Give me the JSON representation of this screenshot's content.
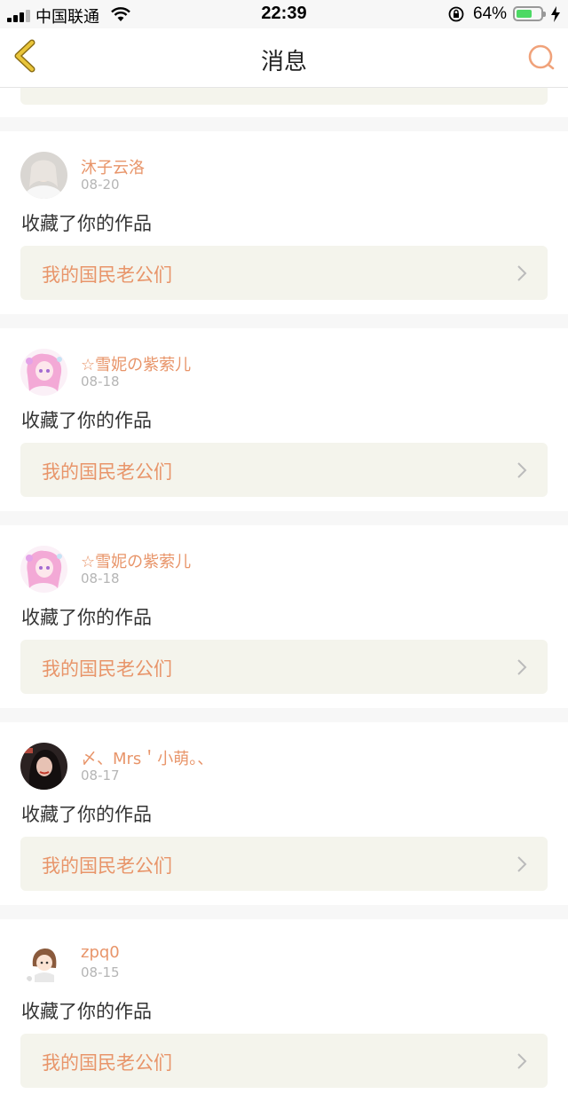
{
  "status_bar": {
    "carrier": "中国联通",
    "time": "22:39",
    "battery": "64%",
    "battery_level": 0.64
  },
  "nav": {
    "title": "消息",
    "back_icon": "chevron-left-icon",
    "search_icon": "search-icon"
  },
  "colors": {
    "accent": "#e8956a",
    "card_box": "#f4f4ec",
    "back_icon": "#c9a62b"
  },
  "messages": [
    {
      "user": "沐子云洛",
      "date": "08-20",
      "action": "收藏了你的作品",
      "work": "我的国民老公们",
      "avatar": "avatar-girl-white"
    },
    {
      "user": "☆雪妮の紫萦儿",
      "date": "08-18",
      "action": "收藏了你的作品",
      "work": "我的国民老公们",
      "avatar": "avatar-anime-pink"
    },
    {
      "user": "☆雪妮の紫萦儿",
      "date": "08-18",
      "action": "收藏了你的作品",
      "work": "我的国民老公们",
      "avatar": "avatar-anime-pink"
    },
    {
      "user": "〆、Mrs＇小萌。、",
      "date": "08-17",
      "action": "收藏了你的作品",
      "work": "我的国民老公们",
      "avatar": "avatar-dark-photo"
    },
    {
      "user": "zpq0",
      "date": "08-15",
      "action": "收藏了你的作品",
      "work": "我的国民老公们",
      "avatar": "avatar-cartoon-girl"
    }
  ]
}
